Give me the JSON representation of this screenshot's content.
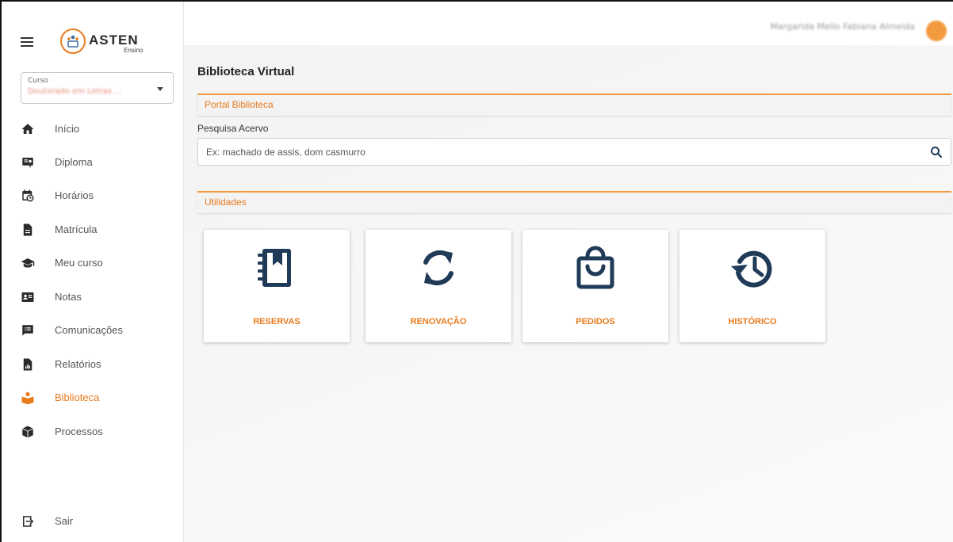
{
  "app": {
    "logo_text": "ASTEN",
    "logo_sub": "Ensino"
  },
  "course": {
    "label": "Curso",
    "value": "Doutorado em Letras ..."
  },
  "nav": {
    "items": [
      {
        "label": "Início",
        "icon": "home-icon"
      },
      {
        "label": "Diploma",
        "icon": "diploma-icon"
      },
      {
        "label": "Horários",
        "icon": "calendar-clock-icon"
      },
      {
        "label": "Matrícula",
        "icon": "document-icon"
      },
      {
        "label": "Meu curso",
        "icon": "graduation-cap-icon"
      },
      {
        "label": "Notas",
        "icon": "id-card-icon"
      },
      {
        "label": "Comunicações",
        "icon": "message-icon"
      },
      {
        "label": "Relatórios",
        "icon": "report-icon"
      },
      {
        "label": "Biblioteca",
        "icon": "library-icon",
        "active": true
      },
      {
        "label": "Processos",
        "icon": "box-icon"
      }
    ],
    "logout": {
      "label": "Sair",
      "icon": "logout-icon"
    }
  },
  "user": {
    "name": "Margarida Mello Fabiana Almeida"
  },
  "page": {
    "title": "Biblioteca Virtual",
    "portal_section": "Portal Biblioteca",
    "search_label": "Pesquisa Acervo",
    "search_placeholder": "Ex: machado de assis, dom casmurro",
    "utilities_section": "Utilidades"
  },
  "cards": [
    {
      "label": "RESERVAS",
      "icon": "notebook-bookmark-icon"
    },
    {
      "label": "RENOVAÇÃO",
      "icon": "sync-icon"
    },
    {
      "label": "PEDIDOS",
      "icon": "shopping-bag-icon"
    },
    {
      "label": "HISTÓRICO",
      "icon": "history-icon"
    }
  ],
  "colors": {
    "accent": "#e87b1d",
    "icon": "#1f3b57",
    "nav_icon": "#2b2b2b"
  }
}
